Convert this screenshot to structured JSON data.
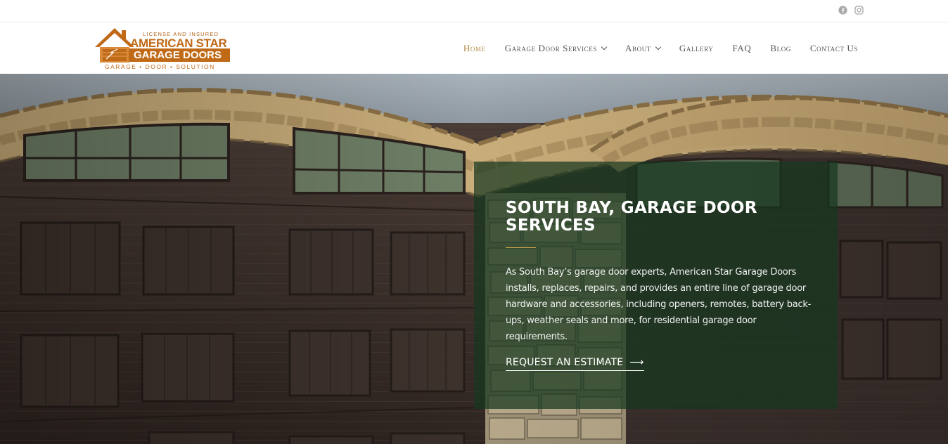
{
  "social": {
    "facebook_icon": "facebook-icon",
    "instagram_icon": "instagram-icon"
  },
  "logo": {
    "tagline_top": "License and Insured",
    "brand_line1": "AMERICAN STAR",
    "brand_line2": "GARAGE DOORS",
    "tagline_bottom": "Garage  •  Door  •  Solution"
  },
  "nav": {
    "items": [
      {
        "label": "Home",
        "active": true
      },
      {
        "label": "Garage Door Services",
        "dropdown": true
      },
      {
        "label": "About",
        "dropdown": true
      },
      {
        "label": "Gallery"
      },
      {
        "label": "FAQ"
      },
      {
        "label": "Blog"
      },
      {
        "label": "Contact Us"
      }
    ]
  },
  "hero": {
    "title": "SOUTH BAY, GARAGE DOOR SERVICES",
    "text": "As South Bay’s garage door experts, American Star Garage Doors installs, replaces, repairs, and provides an entire line of garage door hardware and accessories, including openers, remotes, battery back-ups, weather seals and more, for residential garage door requirements.",
    "cta_label": "REQUEST AN ESTIMATE",
    "cta_arrow": "⟶"
  },
  "colors": {
    "accent": "#b08a3e",
    "brand_orange": "#c06a18",
    "panel_green": "#16381e"
  }
}
